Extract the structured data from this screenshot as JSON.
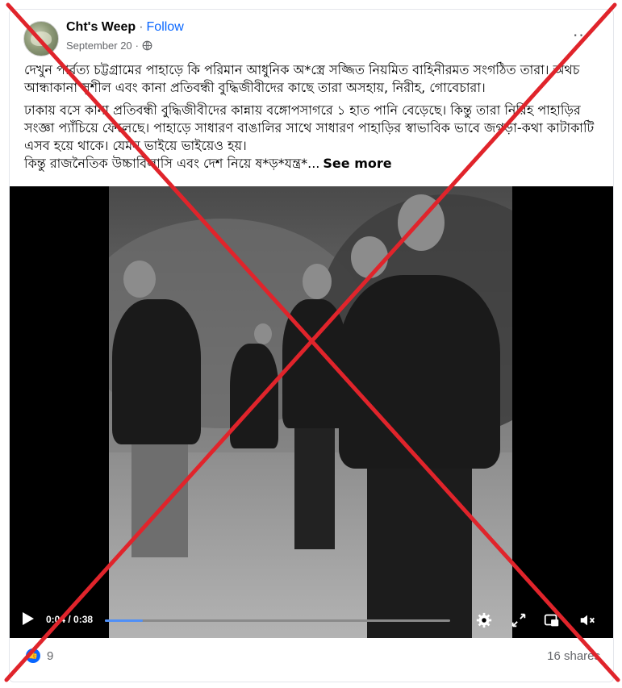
{
  "post": {
    "author": "Cht's Weep",
    "separator": "·",
    "follow_label": "Follow",
    "date": "September 20",
    "privacy_icon": "globe-icon",
    "more_icon": "···",
    "paragraphs": [
      "দেখুন পার্বত্য চট্টগ্রামের পাহাড়ে কি পরিমান আধুনিক অ*স্ত্রে সজ্জিত নিয়মিত বাহিনীরমত সংগঠিত তারা। অথচ আন্ধাকানা সুশীল এবং কানা প্রতিবন্ধী বুদ্ধিজীবীদের কাছে তারা অসহায়, নিরীহ, গোবেচারা।",
      "ঢাকায় বসে কানা প্রতিবন্ধী বুদ্ধিজীবীদের কান্নায় বঙ্গোপসাগরে ১ হাত পানি বেড়েছে। কিন্তু তারা নিরিহ পাহাড়ির সংজ্ঞা প্যাঁচিয়ে ফেলেছে। পাহাড়ে সাধারণ বাঙালির সাথে সাধারণ পাহাড়ির স্বাভাবিক ভাবে জগড়া-কথা কাটাকাটি এসব হয়ে থাকে। যেমন ভাইয়ে ভাইয়েও হয়।",
      "কিন্তু রাজনৈতিক উচ্চাবিলাসি এবং দেশ নিয়ে ষ*ড়*যন্ত্র*..."
    ],
    "see_more": "See more"
  },
  "video": {
    "time": "0:04 / 0:38",
    "progress": 0.11,
    "icons": [
      "play-icon",
      "settings-icon",
      "expand-icon",
      "pip-icon",
      "volume-muted-icon"
    ]
  },
  "footer": {
    "reaction_count": "9",
    "shares": "16 shares"
  },
  "overlay": {
    "mark": "red-x",
    "color": "#e0242b"
  }
}
